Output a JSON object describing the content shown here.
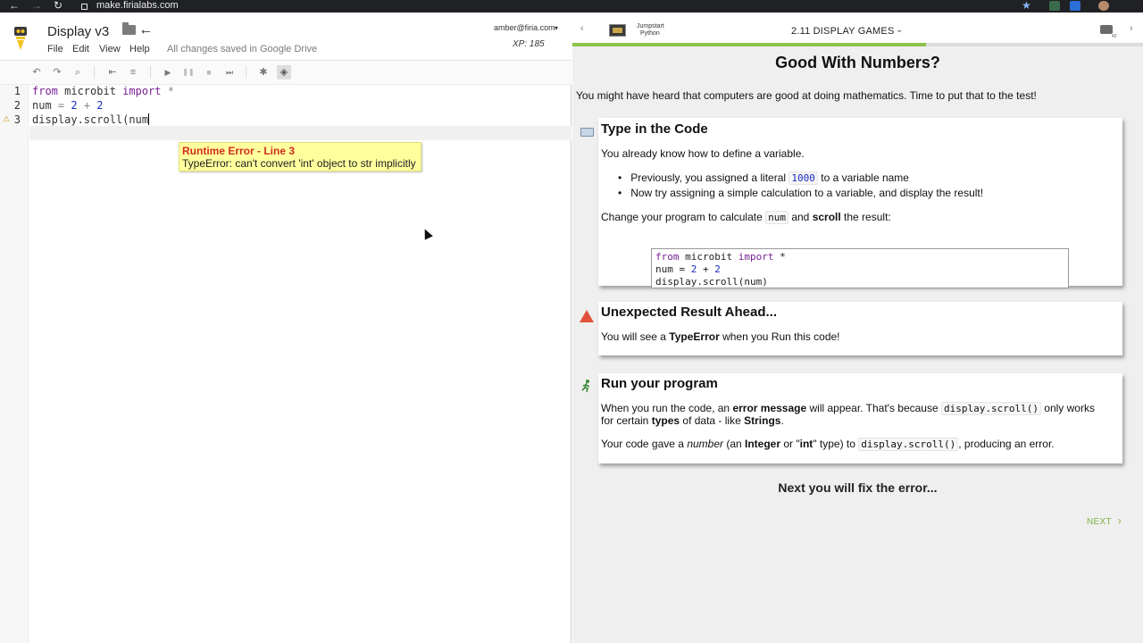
{
  "browser": {
    "url": "make.firialabs.com",
    "back_glyph": "←",
    "forward_glyph": "→",
    "reload_glyph": "↻",
    "lock_glyph": "🔒",
    "bookmark_glyph": "★"
  },
  "editor": {
    "doc_title": "Display v3",
    "menu": [
      "File",
      "Edit",
      "View",
      "Help"
    ],
    "save_status": "All changes saved in Google Drive",
    "user_email": "amber@firia.com",
    "user_caret": "▾",
    "xp": "XP: 185",
    "usb_glyph": "⭠",
    "toolbar_glyphs": {
      "undo": "↶",
      "redo": "↷",
      "search": "⌕",
      "indent": "⇤",
      "format": "≡",
      "run": "▶",
      "pause": "❚❚",
      "stop": "■",
      "step": "⏭",
      "debug": "✱",
      "mode": "◈"
    },
    "line_numbers": [
      "1",
      "2",
      "3"
    ],
    "code": {
      "line1": {
        "kw1": "from",
        "mid": " microbit ",
        "kw2": "import",
        "rest": " *"
      },
      "line2": {
        "a": "num",
        "eq": " = ",
        "n1": "2",
        "plus": " + ",
        "n2": "2"
      },
      "line3": {
        "text": "display.scroll(num"
      }
    },
    "warning_glyph": "⚠",
    "error": {
      "title": "Runtime Error - Line 3",
      "message": "TypeError: can't convert 'int' object to str implicitly"
    }
  },
  "lesson": {
    "course_line1": "Jumpstart",
    "course_line2": "Python",
    "title": "2.11 DISPLAY GAMES",
    "title_caret": "⌄",
    "back_glyph": "‹",
    "fwd_glyph": "›",
    "robot_count": "42",
    "progress": 0.62,
    "heading": "Good With Numbers?",
    "intro": "You might have heard that computers are good at doing mathematics. Time to put that to the test!",
    "card1": {
      "title": "Type in the Code",
      "line1": "You already know how to define a variable.",
      "bullet1_pre": "Previously, you assigned a literal ",
      "bullet1_code": "1000",
      "bullet1_post": " to a variable name",
      "bullet2": "Now try assigning a simple calculation to a variable, and display the result!",
      "change_pre": "Change your program to calculate ",
      "change_code": "num",
      "change_mid": " and ",
      "change_bold": "scroll",
      "change_post": " the result:",
      "code_l1_kw1": "from",
      "code_l1_mid": " microbit ",
      "code_l1_kw2": "import",
      "code_l1_rest": " *",
      "code_l2_a": "num = ",
      "code_l2_n1": "2",
      "code_l2_op": " + ",
      "code_l2_n2": "2",
      "code_l3": "display.scroll(num)"
    },
    "card2": {
      "title": "Unexpected Result Ahead...",
      "pre": "You will see a ",
      "bold": "TypeError",
      "post": " when you Run this code!"
    },
    "card3": {
      "title": "Run your program",
      "p1_a": "When you run the code, an ",
      "p1_b": "error message",
      "p1_c": " will appear. That's because ",
      "p1_code": "display.scroll()",
      "p1_d": " only works",
      "p1_e": "for certain ",
      "p1_f": "types",
      "p1_g": " of data - like ",
      "p1_h": "Strings",
      "p1_i": ".",
      "p2_a": "Your code gave a ",
      "p2_b": "number",
      "p2_c": " (an ",
      "p2_d": "Integer",
      "p2_e": " or \"",
      "p2_f": "int",
      "p2_g": "\" type) to ",
      "p2_code": "display.scroll()",
      "p2_h": ", producing an error."
    },
    "runner_glyph": "🏃",
    "next_heading": "Next you will fix the error...",
    "next_button": "NEXT",
    "next_chevron": "›"
  }
}
